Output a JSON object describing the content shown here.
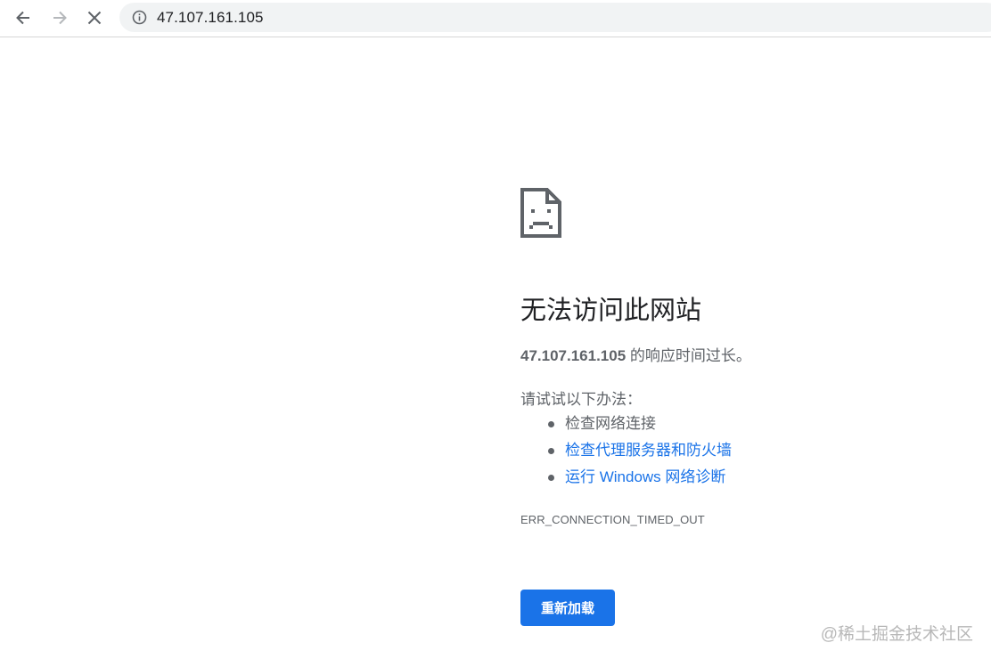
{
  "toolbar": {
    "back_icon": "arrow-left-icon",
    "forward_icon": "arrow-right-icon",
    "stop_icon": "close-icon",
    "info_icon": "info-icon",
    "url": "47.107.161.105"
  },
  "error_page": {
    "icon": "sad-page-icon",
    "title": "无法访问此网站",
    "host": "47.107.161.105",
    "summary_suffix": " 的响应时间过长。",
    "try_label": "请试试以下办法：",
    "suggestions": [
      {
        "text": "检查网络连接",
        "is_link": false
      },
      {
        "text": "检查代理服务器和防火墙",
        "is_link": true
      },
      {
        "text": "运行 Windows 网络诊断",
        "is_link": true
      }
    ],
    "error_code": "ERR_CONNECTION_TIMED_OUT",
    "reload_label": "重新加载"
  },
  "watermark": "@稀土掘金技术社区",
  "colors": {
    "accent": "#1a73e8",
    "text_primary": "#202124",
    "text_secondary": "#5f6368",
    "omnibox_bg": "#f1f3f4"
  }
}
